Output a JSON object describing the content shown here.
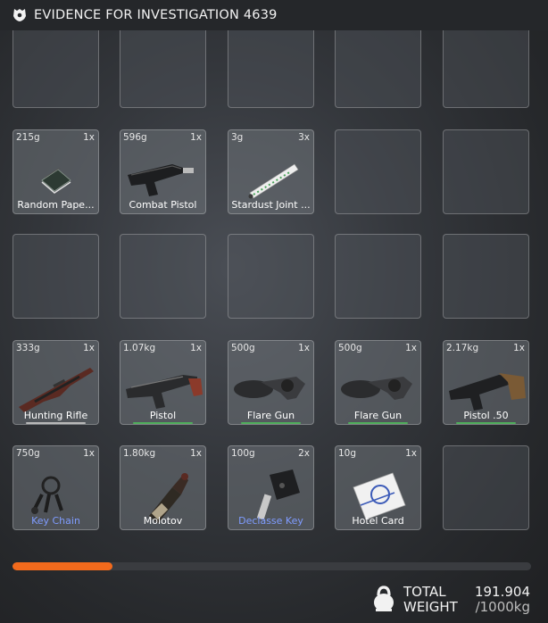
{
  "header": {
    "title": "EVIDENCE FOR INVESTIGATION 4639",
    "icon": "badge-icon"
  },
  "slots": [
    {
      "empty": true
    },
    {
      "empty": true
    },
    {
      "empty": true
    },
    {
      "empty": true
    },
    {
      "empty": true
    },
    {
      "weight": "215g",
      "qty": "1x",
      "label": "Random Pape...",
      "icon": "papers-icon"
    },
    {
      "weight": "596g",
      "qty": "1x",
      "label": "Combat Pistol",
      "icon": "combat-pistol-icon"
    },
    {
      "weight": "3g",
      "qty": "3x",
      "label": "Stardust Joint ...",
      "icon": "joint-icon"
    },
    {
      "empty": true
    },
    {
      "empty": true
    },
    {
      "empty": true
    },
    {
      "empty": true
    },
    {
      "empty": true
    },
    {
      "empty": true
    },
    {
      "empty": true
    },
    {
      "weight": "333g",
      "qty": "1x",
      "label": "Hunting Rifle",
      "icon": "rifle-icon",
      "underline": "#b9b9b9"
    },
    {
      "weight": "1.07kg",
      "qty": "1x",
      "label": "Pistol",
      "icon": "pistol-icon",
      "underline": "#4fae5b"
    },
    {
      "weight": "500g",
      "qty": "1x",
      "label": "Flare Gun",
      "icon": "flare-gun-icon",
      "underline": "#4fae5b"
    },
    {
      "weight": "500g",
      "qty": "1x",
      "label": "Flare Gun",
      "icon": "flare-gun-icon",
      "underline": "#4fae5b"
    },
    {
      "weight": "2.17kg",
      "qty": "1x",
      "label": "Pistol .50",
      "icon": "pistol-50-icon",
      "underline": "#4fae5b"
    },
    {
      "weight": "750g",
      "qty": "1x",
      "label": "Key Chain",
      "icon": "key-chain-icon",
      "label_color": "blue"
    },
    {
      "weight": "1.80kg",
      "qty": "1x",
      "label": "Molotov",
      "icon": "molotov-icon"
    },
    {
      "weight": "100g",
      "qty": "2x",
      "label": "Declasse Key",
      "icon": "car-key-icon",
      "label_color": "blue"
    },
    {
      "weight": "10g",
      "qty": "1x",
      "label": "Hotel Card",
      "icon": "hotel-card-icon"
    },
    {
      "empty": true
    }
  ],
  "weight": {
    "label_line1": "TOTAL",
    "label_line2": "WEIGHT",
    "current": "191.904",
    "max": "/1000kg",
    "fill_fraction": 0.192
  },
  "colors": {
    "accent": "#f26a1c",
    "rare_label": "#7f9cff",
    "quality_green": "#4fae5b"
  }
}
